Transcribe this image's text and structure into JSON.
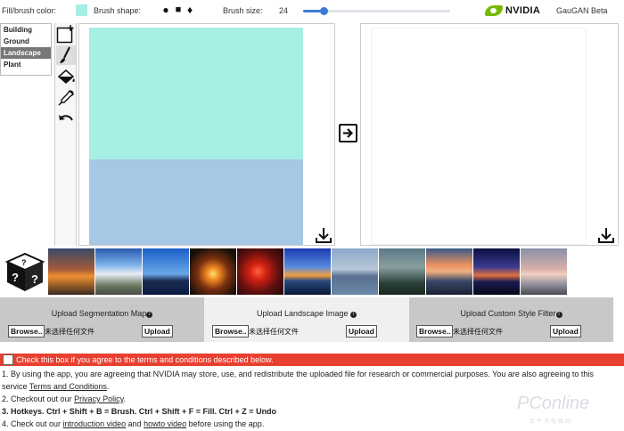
{
  "toolbar": {
    "fill_label": "Fill/brush color:",
    "brush_color": "#a6efe4",
    "shape_label": "Brush shape:",
    "shapes": [
      "●",
      "■",
      "♦"
    ],
    "size_label": "Brush size:",
    "size_value": "24",
    "size_slider_fraction": 0.14,
    "brand": "NVIDIA",
    "app_title": "GauGAN Beta"
  },
  "labels": {
    "items": [
      "Building",
      "Ground",
      "Landscape",
      "Plant"
    ],
    "selected": "Landscape"
  },
  "tools": [
    "new-canvas-icon",
    "brush-icon",
    "fill-bucket-icon",
    "eyedropper-icon",
    "undo-icon"
  ],
  "segmentation": {
    "colors": {
      "top": "#a6efe4",
      "bottom": "#a6c8e4"
    }
  },
  "thumbnails": {
    "random_icon": "dice-icon",
    "images": [
      "t1",
      "t2",
      "t3",
      "t4",
      "t5",
      "t6",
      "t7",
      "t8",
      "t9",
      "t10",
      "t11"
    ]
  },
  "uploads": [
    {
      "title": "Upload Segmentation Map",
      "browse": "Browse..",
      "nofile": "未选择任何文件",
      "button": "Upload"
    },
    {
      "title": "Upload Landscape Image",
      "browse": "Browse..",
      "nofile": "未选择任何文件",
      "button": "Upload"
    },
    {
      "title": "Upload Custom Style Filter",
      "browse": "Browse..",
      "nofile": "未选择任何文件",
      "button": "Upload"
    }
  ],
  "terms": {
    "checkbox_text": "Check this box if you agree to the terms and conditions described below.",
    "line1_a": "1. By using the app, you are agreeing that NVIDIA may store, use, and redistribute the uploaded file for research or commercial purposes. You are also agreeing to this service ",
    "line1_link": "Terms and Conditions",
    "line1_b": ".",
    "line2_a": "2. Checkout out our ",
    "line2_link": "Privacy Policy",
    "line2_b": ".",
    "line3": "3. Hotkeys. Ctrl + Shift + B = Brush. Ctrl + Shift + F = Fill. Ctrl + Z = Undo",
    "line4_a": "4. Check out our ",
    "line4_link1": "introduction video",
    "line4_mid": " and ",
    "line4_link2": "howto video",
    "line4_b": " before using the app."
  },
  "watermark": {
    "main": "PConline",
    "sub": "太平洋电脑网"
  }
}
